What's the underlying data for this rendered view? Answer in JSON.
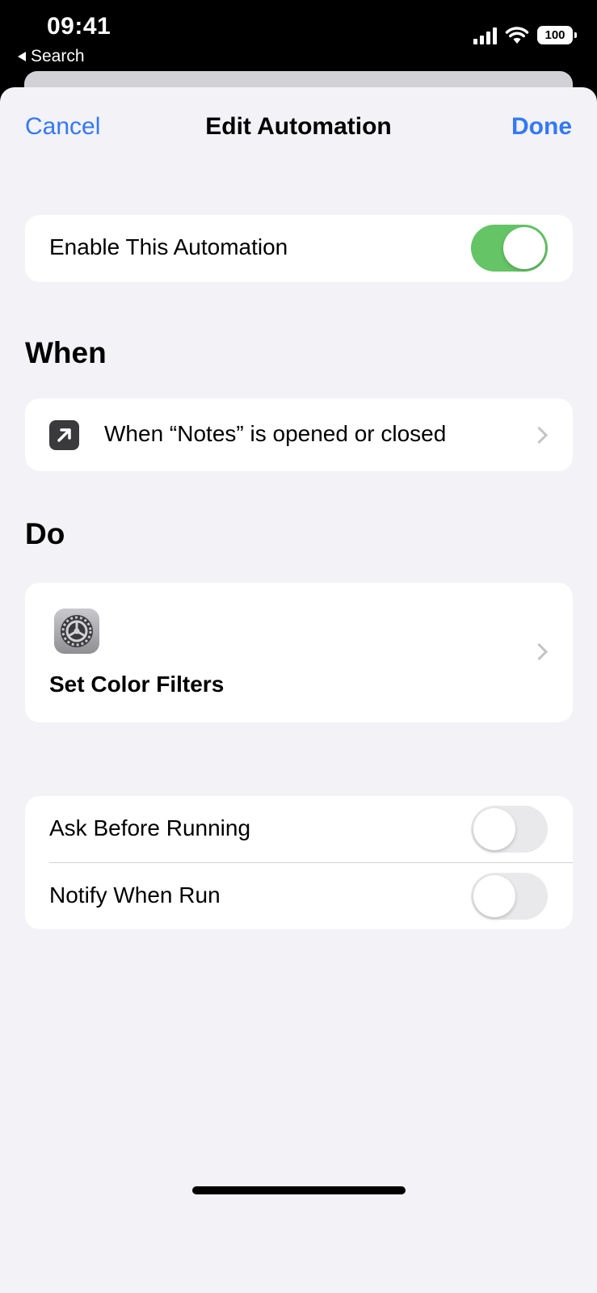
{
  "status_bar": {
    "time": "09:41",
    "back_label": "Search",
    "battery": "100"
  },
  "nav": {
    "cancel_label": "Cancel",
    "title": "Edit Automation",
    "done_label": "Done"
  },
  "enable": {
    "label": "Enable This Automation",
    "enabled": true
  },
  "when_section": {
    "header": "When",
    "trigger_label": "When “Notes” is opened or closed",
    "trigger_icon": "arrow-up-right-icon"
  },
  "do_section": {
    "header": "Do",
    "action_label": "Set Color Filters",
    "action_icon": "settings-gear-icon"
  },
  "options": [
    {
      "label": "Ask Before Running",
      "enabled": false
    },
    {
      "label": "Notify When Run",
      "enabled": false
    }
  ],
  "colors": {
    "accent": "#3478f6",
    "toggle_on": "#65c466",
    "background": "#f2f2f7"
  }
}
